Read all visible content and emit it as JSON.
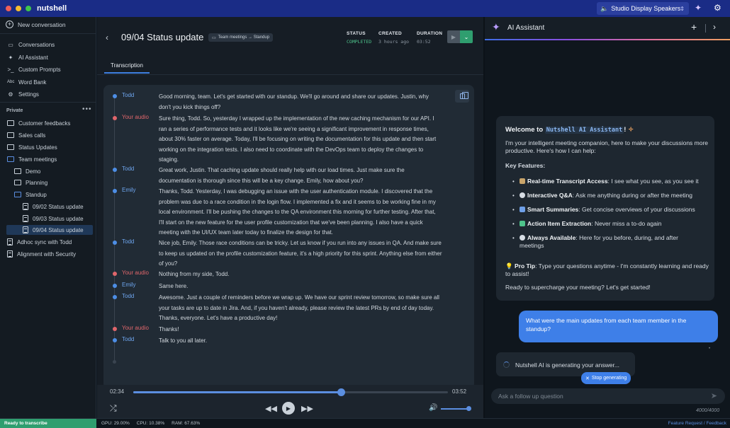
{
  "app": {
    "name": "nutshell"
  },
  "titlebar": {
    "speaker": "Studio Display Speakers"
  },
  "sidebar": {
    "new_conversation": "New conversation",
    "nav": [
      {
        "label": "Conversations",
        "icon": "folder-icon"
      },
      {
        "label": "AI Assistant",
        "icon": "sparkle-icon"
      },
      {
        "label": "Custom Prompts",
        "icon": "terminal-icon"
      },
      {
        "label": "Word Bank",
        "icon": "abc-icon"
      },
      {
        "label": "Settings",
        "icon": "gear-icon"
      }
    ],
    "section_label": "Private",
    "section_more": "•••",
    "tree": [
      {
        "label": "Customer feedbacks",
        "type": "folder"
      },
      {
        "label": "Sales calls",
        "type": "folder"
      },
      {
        "label": "Status Updates",
        "type": "folder"
      },
      {
        "label": "Team meetings",
        "type": "folder-open"
      },
      {
        "label": "Demo",
        "type": "folder"
      },
      {
        "label": "Planning",
        "type": "folder"
      },
      {
        "label": "Standup",
        "type": "folder-open"
      },
      {
        "label": "09/02 Status update",
        "type": "doc"
      },
      {
        "label": "09/03 Status update",
        "type": "doc"
      },
      {
        "label": "09/04 Status update",
        "type": "doc",
        "active": true
      },
      {
        "label": "Adhoc sync with Todd",
        "type": "doc"
      },
      {
        "label": "Alignment with Security",
        "type": "doc"
      }
    ]
  },
  "main": {
    "title": "09/04 Status update",
    "breadcrumb": "Team meetings → Standup",
    "status_label": "STATUS",
    "status_value": "COMPLETED",
    "created_label": "CREATED",
    "created_value": "3 hours ago",
    "duration_label": "DURATION",
    "duration_value": "03:52",
    "tab": "Transcription",
    "transcript": [
      {
        "speaker": "Todd",
        "color": "blue",
        "text": "Good morning, team. Let's get started with our standup. We'll go around and share our updates. Justin, why don't you kick things off?"
      },
      {
        "speaker": "Your audio",
        "color": "red",
        "text": "Sure thing, Todd. So, yesterday I wrapped up the implementation of the new caching mechanism for our API. I ran a series of performance tests and it looks like we're seeing a significant improvement in response times, about 30% faster on average. Today, I'll be focusing on writing the documentation for this update and then start working on the integration tests. I also need to coordinate with the DevOps team to deploy the changes to staging."
      },
      {
        "speaker": "Todd",
        "color": "blue",
        "text": "Great work, Justin. That caching update should really help with our load times. Just make sure the documentation is thorough since this will be a key change. Emily, how about you?"
      },
      {
        "speaker": "Emily",
        "color": "blue",
        "text": "Thanks, Todd. Yesterday, I was debugging an issue with the user authentication module. I discovered that the problem was due to a race condition in the login flow. I implemented a fix and it seems to be working fine in my local environment. I'll be pushing the changes to the QA environment this morning for further testing. After that, I'll start on the new feature for the user profile customization that we've been planning. I also have a quick meeting with the UI/UX team later today to finalize the design for that."
      },
      {
        "speaker": "Todd",
        "color": "blue",
        "text": "Nice job, Emily. Those race conditions can be tricky. Let us know if you run into any issues in QA. And make sure to keep us updated on the profile customization feature, it's a high priority for this sprint. Anything else from either of you?"
      },
      {
        "speaker": "Your audio",
        "color": "red",
        "text": "Nothing from my side, Todd."
      },
      {
        "speaker": "Emily",
        "color": "blue",
        "text": "Same here."
      },
      {
        "speaker": "Todd",
        "color": "blue",
        "text": "Awesome. Just a couple of reminders before we wrap up. We have our sprint review tomorrow, so make sure all your tasks are up to date in Jira. And, if you haven't already, please review the latest PRs by end of day today. Thanks, everyone. Let's have a productive day!"
      },
      {
        "speaker": "Your audio",
        "color": "red",
        "text": "Thanks!"
      },
      {
        "speaker": "Todd",
        "color": "blue",
        "text": "Talk to you all later."
      }
    ],
    "player": {
      "current": "02:34",
      "total": "03:52",
      "progress": 0.66,
      "volume": 1.0
    }
  },
  "ai": {
    "title": "AI Assistant",
    "welcome_prefix": "Welcome to",
    "welcome_name": "Nutshell AI Assistant",
    "welcome_suffix": "!",
    "intro": "I'm your intelligent meeting companion, here to make your discussions more productive. Here's how I can help:",
    "key_features_label": "Key Features:",
    "features": [
      {
        "title": "Real-time Transcript Access",
        "desc": ": I see what you see, as you see it",
        "icon_color": "#c9a46a"
      },
      {
        "title": "Interactive Q&A",
        "desc": ": Ask me anything during or after the meeting",
        "icon_color": "#d7dde4"
      },
      {
        "title": "Smart Summaries",
        "desc": ": Get concise overviews of your discussions",
        "icon_color": "#6fa0e8"
      },
      {
        "title": "Action Item Extraction",
        "desc": ": Never miss a to-do again",
        "icon_color": "#4ec38b"
      },
      {
        "title": "Always Available",
        "desc": ": Here for you before, during, and after meetings",
        "icon_color": "#d7dde4"
      }
    ],
    "pro_tip_label": "Pro Tip",
    "pro_tip": ": Type your questions anytime - I'm constantly learning and ready to assist!",
    "cta": "Ready to supercharge your meeting? Let's get started!",
    "user_message": "What were the main updates from each team member in the standup?",
    "generating": "Nutshell AI is generating your answer...",
    "stop_label": "Stop generating",
    "input_placeholder": "Ask a follow up question",
    "counter": "4000/4000"
  },
  "statusbar": {
    "ready": "Ready to transcribe",
    "gpu": "GPU: 29.00%",
    "cpu": "CPU: 10.38%",
    "ram": "RAM: 67.63%",
    "feedback": "Feature Request / Feedback"
  }
}
